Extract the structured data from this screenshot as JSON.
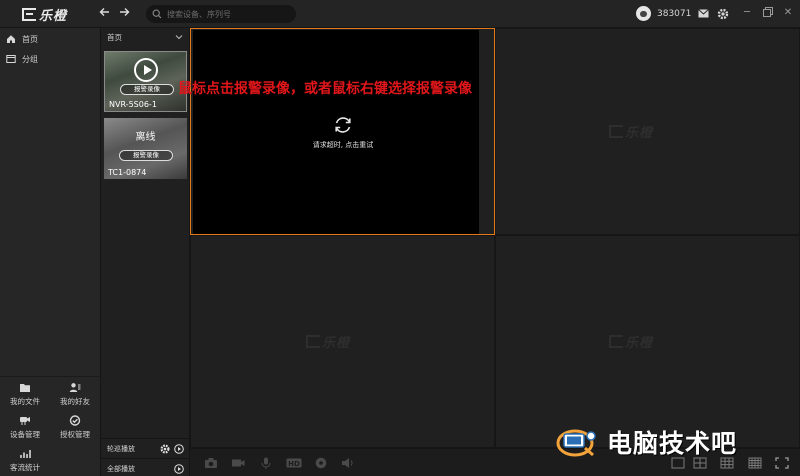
{
  "app": {
    "logo_text": "乐橙"
  },
  "header": {
    "search_placeholder": "搜索设备、序列号",
    "user_id": "383071"
  },
  "sidebar": {
    "items": [
      {
        "label": "首页",
        "icon": "home-icon"
      },
      {
        "label": "分组",
        "icon": "folder-icon"
      }
    ],
    "tools": [
      {
        "label": "我的文件",
        "icon": "folder-icon"
      },
      {
        "label": "我的好友",
        "icon": "friends-icon"
      },
      {
        "label": "设备管理",
        "icon": "camera-manage-icon"
      },
      {
        "label": "授权管理",
        "icon": "auth-icon"
      },
      {
        "label": "客流统计",
        "icon": "stats-icon"
      }
    ]
  },
  "device_panel": {
    "header": "首页",
    "devices": [
      {
        "name": "NVR-5S06-1",
        "button": "报警录像",
        "status": ""
      },
      {
        "name": "TC1-0874",
        "button": "报警录像",
        "status": "离线"
      }
    ],
    "footer": [
      {
        "label": "轮巡播放"
      },
      {
        "label": "全部播放"
      }
    ]
  },
  "player": {
    "timeout_message": "请求超时, 点击重试",
    "watermark": "乐橙"
  },
  "annotation": "鼠标点击报警录像，或者鼠标右键选择报警录像",
  "brand": {
    "text": "电脑技术吧"
  },
  "colors": {
    "accent": "#e07a1a",
    "annotation": "#e0161a",
    "background": "#1f1f1f"
  }
}
